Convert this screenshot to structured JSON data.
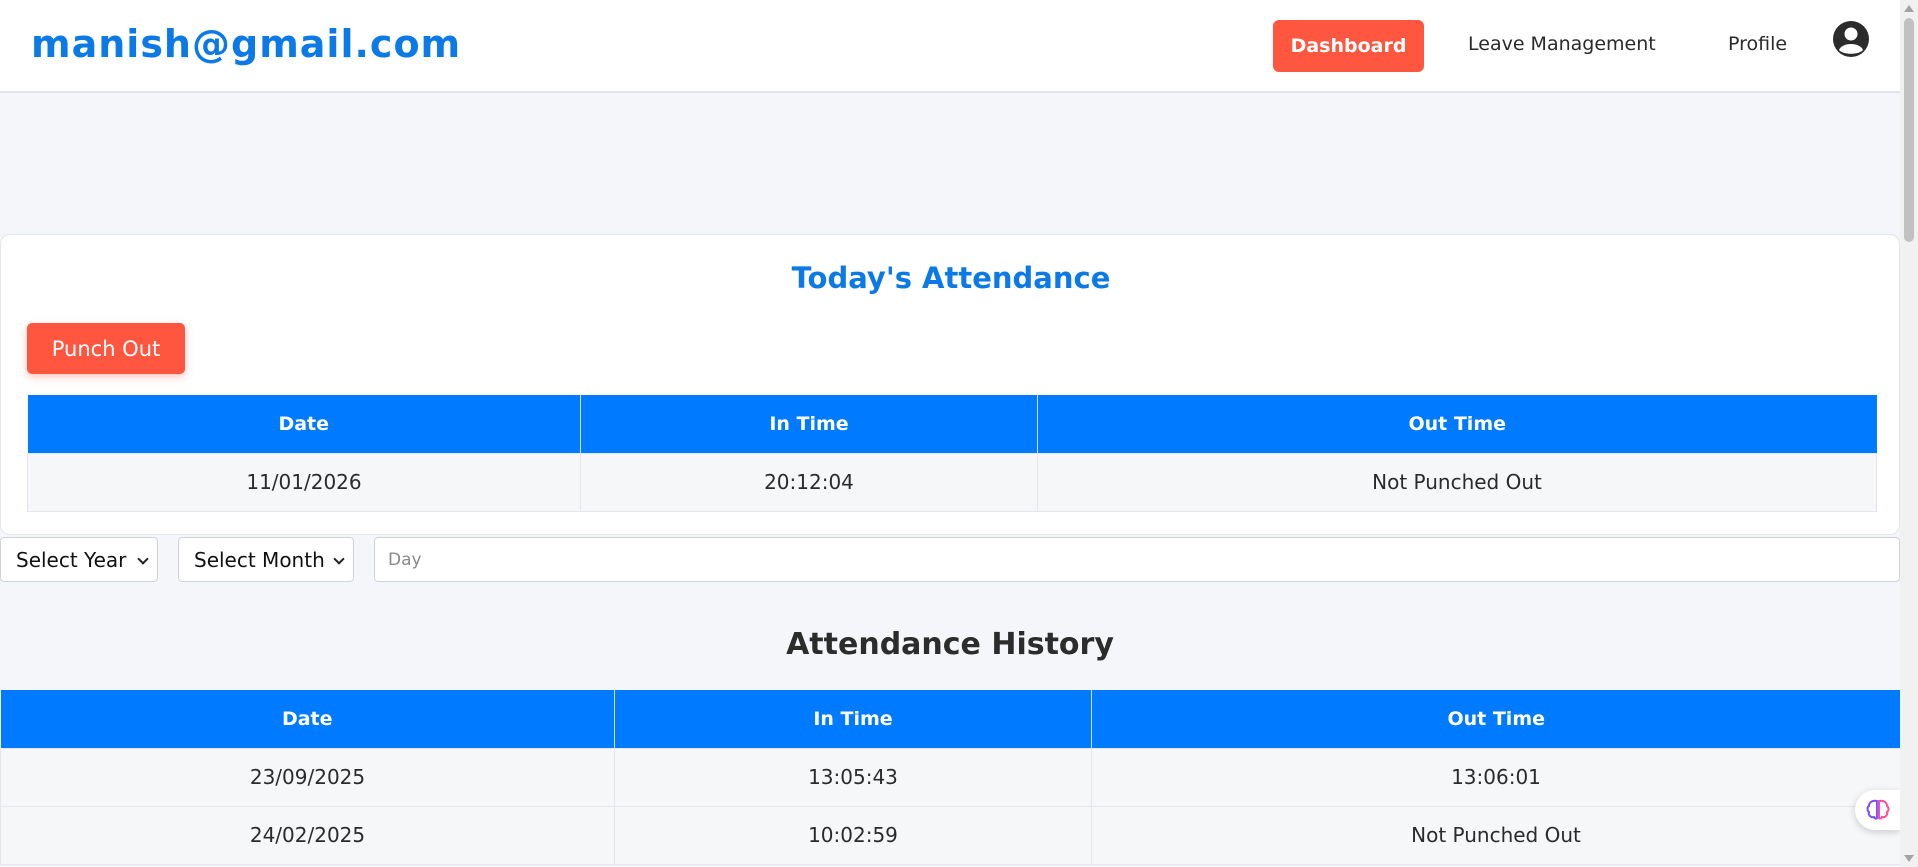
{
  "header": {
    "brand": "manish@gmail.com",
    "nav": {
      "dashboard": "Dashboard",
      "leave": "Leave Management",
      "profile": "Profile"
    }
  },
  "today": {
    "title": "Today's Attendance",
    "punch_button": "Punch Out",
    "columns": [
      "Date",
      "In Time",
      "Out Time"
    ],
    "row": [
      "11/01/2026",
      "20:12:04",
      "Not Punched Out"
    ]
  },
  "filters": {
    "year_selected": "Select Year",
    "month_selected": "Select Month",
    "day_placeholder": "Day"
  },
  "history": {
    "title": "Attendance History",
    "columns": [
      "Date",
      "In Time",
      "Out Time"
    ],
    "rows": [
      [
        "23/09/2025",
        "13:05:43",
        "13:06:01"
      ],
      [
        "24/02/2025",
        "10:02:59",
        "Not Punched Out"
      ]
    ]
  },
  "colors": {
    "primary": "#007bff",
    "accent": "#ff5640",
    "brand": "#0b7ae6"
  },
  "icons": {
    "avatar": "user-circle-icon",
    "widget": "brain-icon"
  }
}
